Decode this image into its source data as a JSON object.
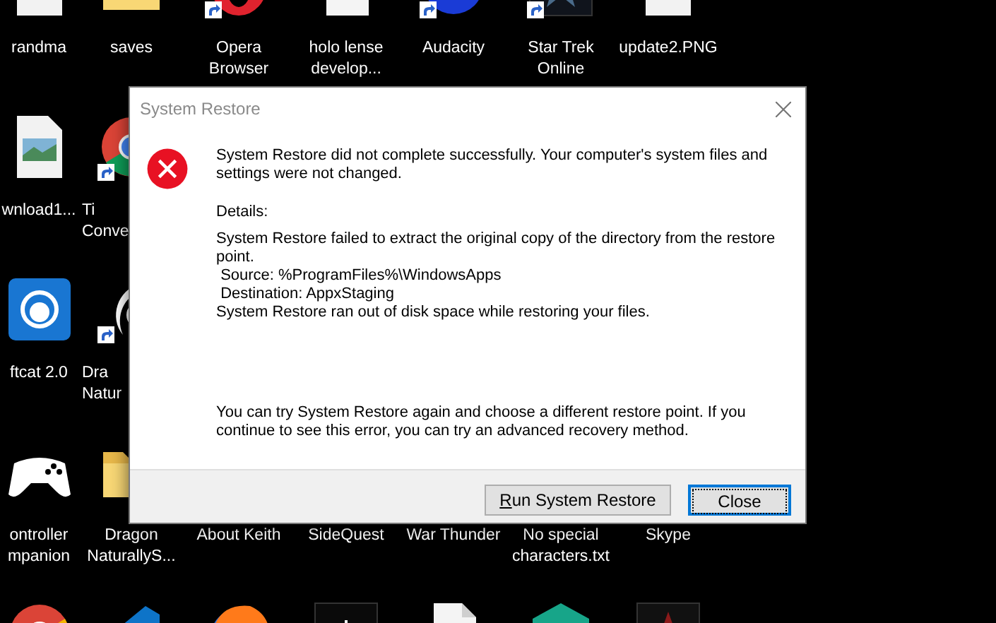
{
  "desktop": {
    "rows": [
      {
        "icons": [
          {
            "label": "randma",
            "kind": "image",
            "shortcut": false,
            "covered": false
          },
          {
            "label": "saves",
            "kind": "folder",
            "shortcut": false,
            "covered": false
          },
          {
            "label": "Opera\nBrowser",
            "kind": "ring",
            "shortcut": true,
            "covered": false
          },
          {
            "label": "holo lense\ndevelop...",
            "kind": "document",
            "shortcut": false,
            "covered": false
          },
          {
            "label": "Audacity",
            "kind": "waveform",
            "shortcut": true,
            "covered": false
          },
          {
            "label": "Star Trek\nOnline",
            "kind": "insignia",
            "shortcut": true,
            "covered": false
          },
          {
            "label": "update2.PNG",
            "kind": "image",
            "shortcut": false,
            "covered": false
          }
        ]
      },
      {
        "icons": [
          {
            "label": "wnload1...",
            "kind": "image",
            "shortcut": false,
            "covered": false
          },
          {
            "label": "Ti\nConve",
            "kind": "ringlogo",
            "shortcut": true,
            "covered": true
          }
        ]
      },
      {
        "icons": [
          {
            "label": "ftcat 2.0",
            "kind": "cat",
            "shortcut": false,
            "covered": false
          },
          {
            "label": "Dra\nNatur",
            "kind": "swirl",
            "shortcut": true,
            "covered": true
          }
        ]
      },
      {
        "icons": [
          {
            "label": "ontroller\nmpanion",
            "kind": "gamepad",
            "shortcut": false,
            "covered": false
          },
          {
            "label": "Dragon\nNaturallyS...",
            "kind": "folder",
            "shortcut": false,
            "covered": false
          },
          {
            "label": "About Keith",
            "covered": false
          },
          {
            "label": "SideQuest",
            "covered": false
          },
          {
            "label": "War Thunder",
            "covered": false
          },
          {
            "label": "No special\ncharacters.txt",
            "covered": false
          },
          {
            "label": "Skype",
            "covered": false
          }
        ]
      },
      {
        "icons": [
          {
            "kind": "ringlogo"
          },
          {
            "kind": "ribbon"
          },
          {
            "kind": "globe"
          },
          {
            "kind": "equalizer"
          },
          {
            "kind": "document"
          },
          {
            "kind": "hexagon"
          },
          {
            "kind": "star"
          }
        ]
      }
    ]
  },
  "dialog": {
    "title": "System Restore",
    "kind": "error",
    "message": "System Restore did not complete successfully. Your computer's system files and settings were not changed.",
    "details_heading": "Details:",
    "details": [
      "System Restore failed to extract the original copy of the directory from the restore point.",
      " Source: %ProgramFiles%\\WindowsApps",
      " Destination: AppxStaging",
      "System Restore ran out of disk space while restoring your files."
    ],
    "advice": "You can try System Restore again and choose a different restore point. If you continue to see this error, you can try an advanced recovery method.",
    "buttons": [
      {
        "label": "Run System Restore",
        "underline_first": true,
        "focused": false
      },
      {
        "label": "Close",
        "underline_first": false,
        "focused": true
      }
    ]
  }
}
